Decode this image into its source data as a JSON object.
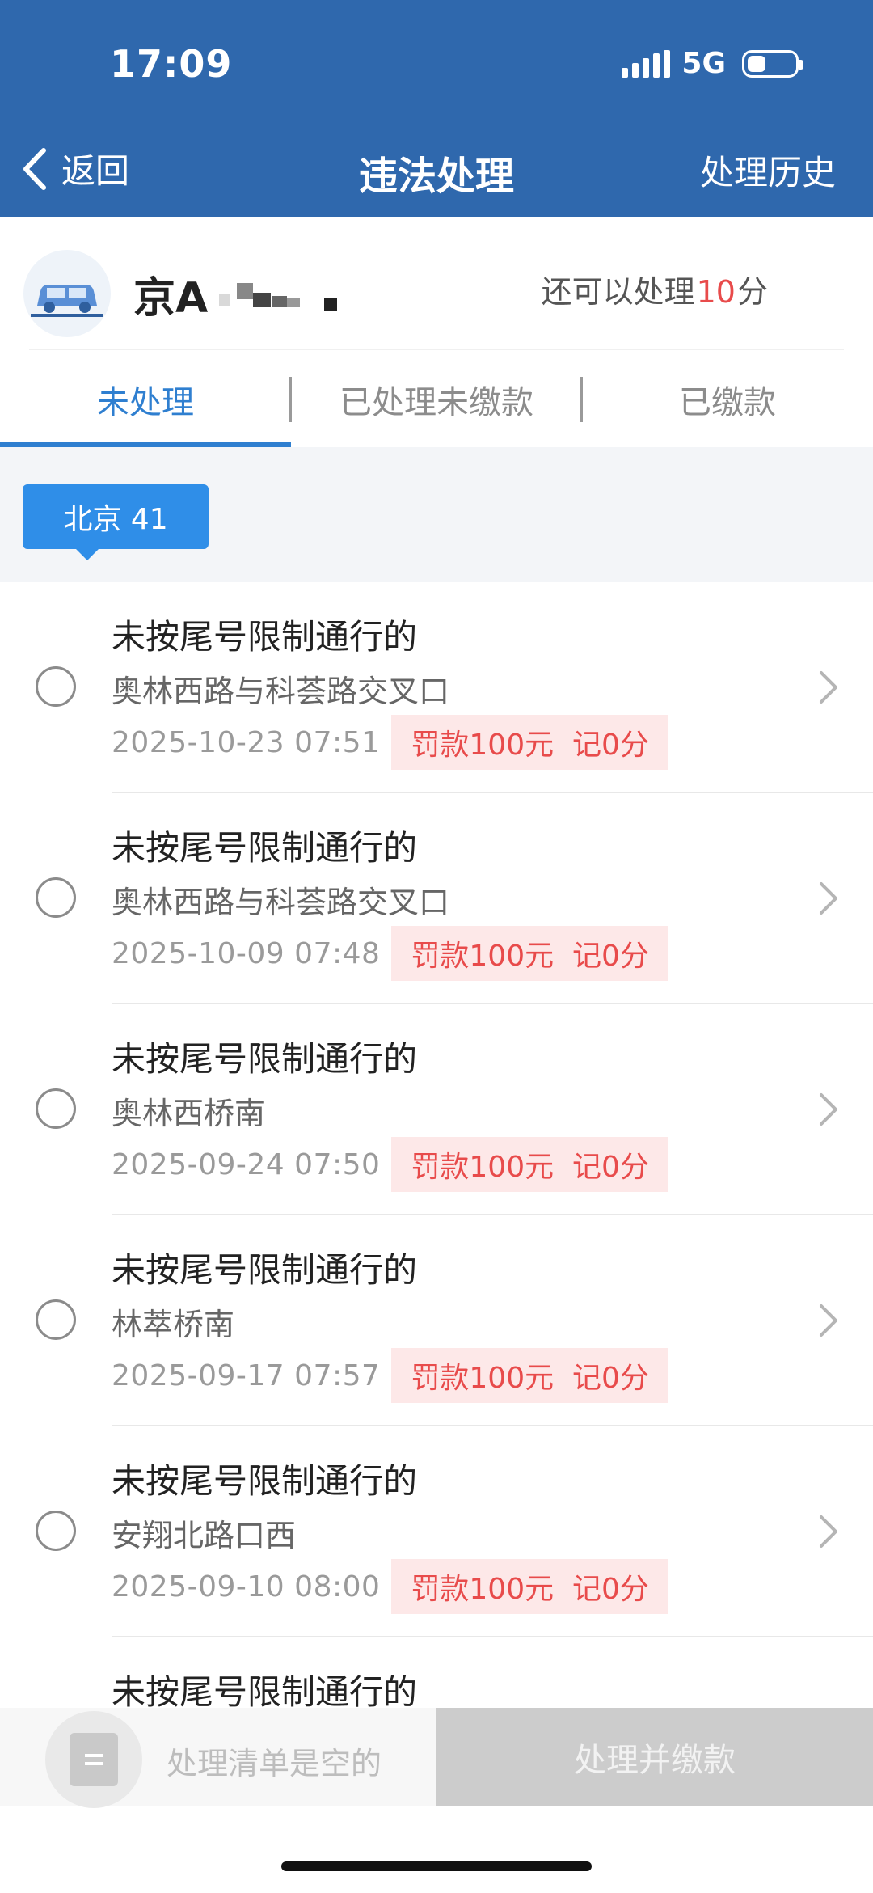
{
  "status_bar": {
    "time": "17:09",
    "network": "5G",
    "signal_icon": "signal-icon",
    "battery_icon": "battery-icon"
  },
  "nav": {
    "back_label": "返回",
    "title": "违法处理",
    "history_label": "处理历史"
  },
  "vehicle": {
    "plate_prefix": "京A",
    "remaining_prefix": "还可以处理",
    "remaining_points": "10",
    "remaining_unit": "分"
  },
  "tabs": [
    {
      "label": "未处理",
      "active": true
    },
    {
      "label": "已处理未缴款",
      "active": false
    },
    {
      "label": "已缴款",
      "active": false
    }
  ],
  "region": {
    "label": "北京 41"
  },
  "violations": [
    {
      "title": "未按尾号限制通行的",
      "location": "奥林西路与科荟路交叉口",
      "datetime": "2025-10-23 07:51",
      "fine": "罚款100元  记0分"
    },
    {
      "title": "未按尾号限制通行的",
      "location": "奥林西路与科荟路交叉口",
      "datetime": "2025-10-09 07:48",
      "fine": "罚款100元  记0分"
    },
    {
      "title": "未按尾号限制通行的",
      "location": "奥林西桥南",
      "datetime": "2025-09-24 07:50",
      "fine": "罚款100元  记0分"
    },
    {
      "title": "未按尾号限制通行的",
      "location": "林萃桥南",
      "datetime": "2025-09-17 07:57",
      "fine": "罚款100元  记0分"
    },
    {
      "title": "未按尾号限制通行的",
      "location": "安翔北路口西",
      "datetime": "2025-09-10 08:00",
      "fine": "罚款100元  记0分"
    },
    {
      "title": "未按尾号限制通行的",
      "location": "",
      "datetime": "",
      "fine": ""
    }
  ],
  "bottom": {
    "empty_text": "处理清单是空的",
    "pay_button": "处理并缴款"
  },
  "colors": {
    "header_blue": "#2f68ad",
    "accent_blue": "#2f7fd0",
    "fine_red": "#e84b4b",
    "fine_bg": "#fde8e8"
  }
}
